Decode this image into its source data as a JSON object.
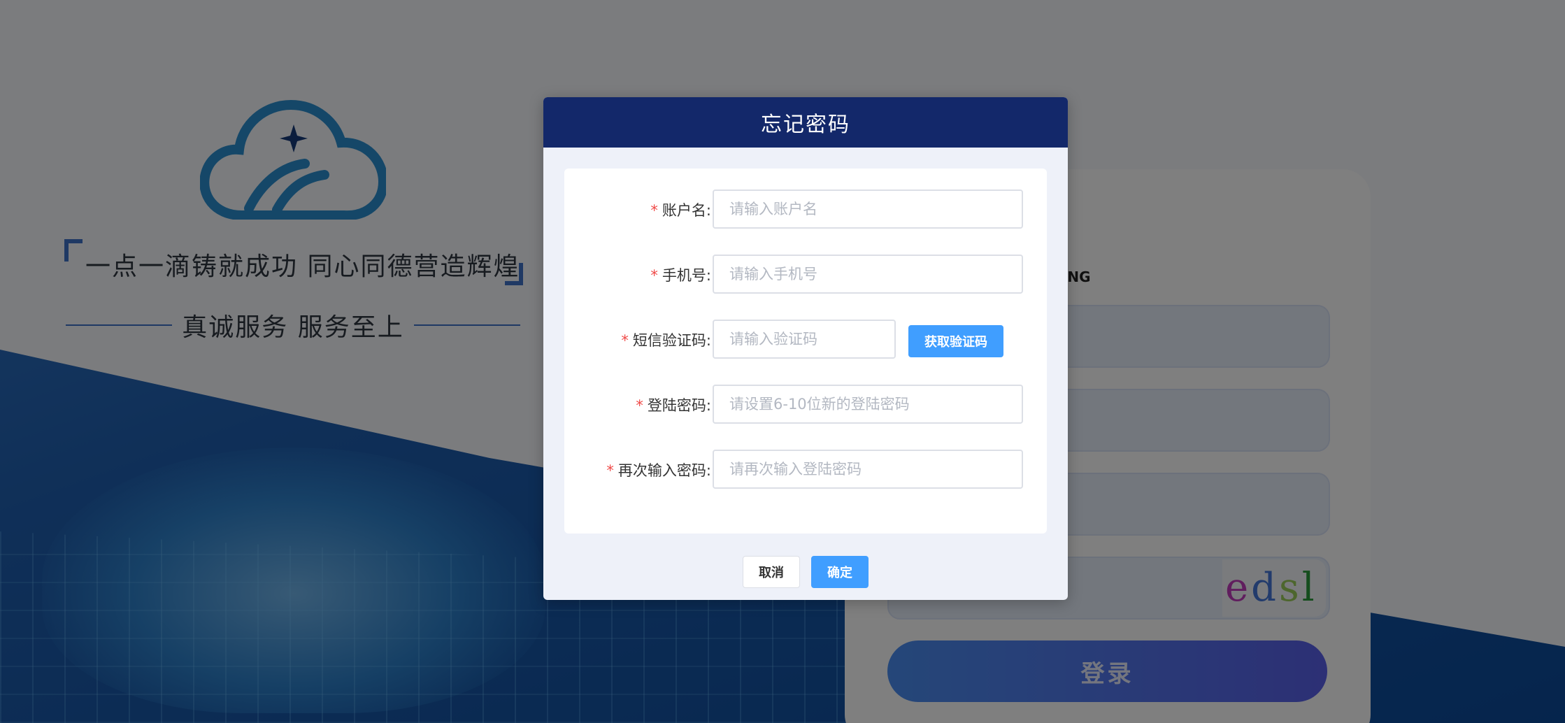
{
  "background": {
    "slogan_main": "一点一滴铸就成功 同心同德营造辉煌",
    "slogan_sub": "真诚服务 服务至上",
    "login_brand_fragment": "XIANG",
    "captcha_chars": [
      {
        "ch": "e",
        "color": "#c03bbd"
      },
      {
        "ch": "d",
        "color": "#4477d8"
      },
      {
        "ch": "s",
        "color": "#9acd5a"
      },
      {
        "ch": "l",
        "color": "#2b9a3b"
      }
    ],
    "login_button": "登录"
  },
  "dialog": {
    "title": "忘记密码",
    "fields": [
      {
        "label": "账户名:",
        "placeholder": "请输入账户名",
        "value": ""
      },
      {
        "label": "手机号:",
        "placeholder": "请输入手机号",
        "value": ""
      },
      {
        "label": "短信验证码:",
        "placeholder": "请输入验证码",
        "value": ""
      },
      {
        "label": "登陆密码:",
        "placeholder": "请设置6-10位新的登陆密码",
        "value": ""
      },
      {
        "label": "再次输入密码:",
        "placeholder": "请再次输入登陆密码",
        "value": ""
      }
    ],
    "required_mark": "*",
    "sms_button": "获取验证码",
    "cancel_button": "取消",
    "ok_button": "确定"
  },
  "colors": {
    "header": "#13286a",
    "primary": "#409eff",
    "required": "#f04a48"
  }
}
